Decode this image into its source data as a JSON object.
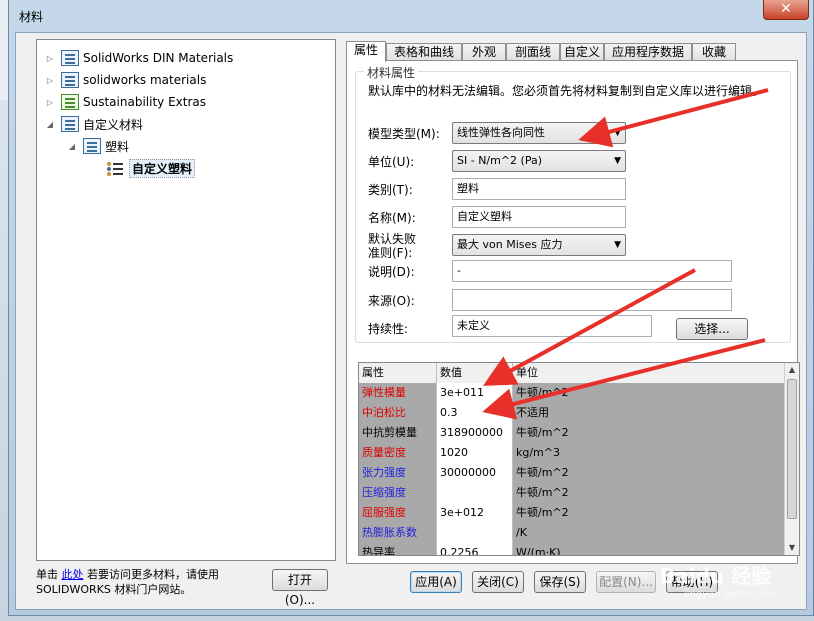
{
  "window": {
    "title": "材料",
    "close_glyph": "✕"
  },
  "tree": {
    "items": [
      {
        "label": "SolidWorks DIN Materials",
        "icon": "library-icon",
        "expander": "▷"
      },
      {
        "label": "solidworks materials",
        "icon": "library-icon",
        "expander": "▷"
      },
      {
        "label": "Sustainability Extras",
        "icon": "library-icon-green",
        "expander": "▷"
      },
      {
        "label": "自定义材料",
        "icon": "library-icon",
        "expander": "◢"
      },
      {
        "label": "塑料",
        "icon": "library-icon",
        "expander": "◢"
      },
      {
        "label": "自定义塑料",
        "icon": "material-icon",
        "expander": ""
      }
    ]
  },
  "footer": {
    "note_prefix": "单击 ",
    "note_link": "此处",
    "note_suffix": " 若要访问更多材料，请使用 SOLIDWORKS 材料门户网站。",
    "open_button": "打开(O)..."
  },
  "tabs": [
    "属性",
    "表格和曲线",
    "外观",
    "剖面线",
    "自定义",
    "应用程序数据",
    "收藏"
  ],
  "properties": {
    "group_title": "材料属性",
    "note": "默认库中的材料无法编辑。您必须首先将材料复制到自定义库以进行编辑。",
    "model_type_label": "模型类型(M):",
    "model_type_value": "线性弹性各向同性",
    "units_label": "单位(U):",
    "units_value": "SI - N/m^2 (Pa)",
    "category_label": "类别(T):",
    "category_value": "塑料",
    "name_label": "名称(M):",
    "name_value": "自定义塑料",
    "failure_label_line1": "默认失败",
    "failure_label_line2": "准则(F):",
    "failure_value": "最大 von Mises 应力",
    "description_label": "说明(D):",
    "description_value": "-",
    "source_label": "来源(O):",
    "source_value": "",
    "sustainability_label": "持续性:",
    "sustainability_value": "未定义",
    "select_button": "选择..."
  },
  "grid": {
    "headers": [
      "属性",
      "数值",
      "单位"
    ],
    "rows": [
      {
        "name": "弹性模量",
        "value": "3e+011",
        "unit": "牛顿/m^2",
        "color": "red"
      },
      {
        "name": "中泊松比",
        "value": "0.3",
        "unit": "不适用",
        "color": "red"
      },
      {
        "name": "中抗剪模量",
        "value": "318900000",
        "unit": "牛顿/m^2",
        "color": "black"
      },
      {
        "name": "质量密度",
        "value": "1020",
        "unit": "kg/m^3",
        "color": "red"
      },
      {
        "name": "张力强度",
        "value": "30000000",
        "unit": "牛顿/m^2",
        "color": "blue"
      },
      {
        "name": "压缩强度",
        "value": "",
        "unit": "牛顿/m^2",
        "color": "blue"
      },
      {
        "name": "屈服强度",
        "value": "3e+012",
        "unit": "牛顿/m^2",
        "color": "red"
      },
      {
        "name": "热膨胀系数",
        "value": "",
        "unit": "/K",
        "color": "blue"
      },
      {
        "name": "热导率",
        "value": "0.2256",
        "unit": "W/(m·K)",
        "color": "black"
      }
    ]
  },
  "buttons": {
    "apply": "应用(A)",
    "close": "关闭(C)",
    "save": "保存(S)",
    "config": "配置(N)...",
    "help": "帮助(H)"
  },
  "colors": {
    "annotation_arrow": "#e8302a",
    "label_red": "#e00000",
    "label_blue": "#1f1fe0"
  },
  "watermark": {
    "main": "Baidu 经验",
    "sub": "jingyan.baidu.com"
  }
}
